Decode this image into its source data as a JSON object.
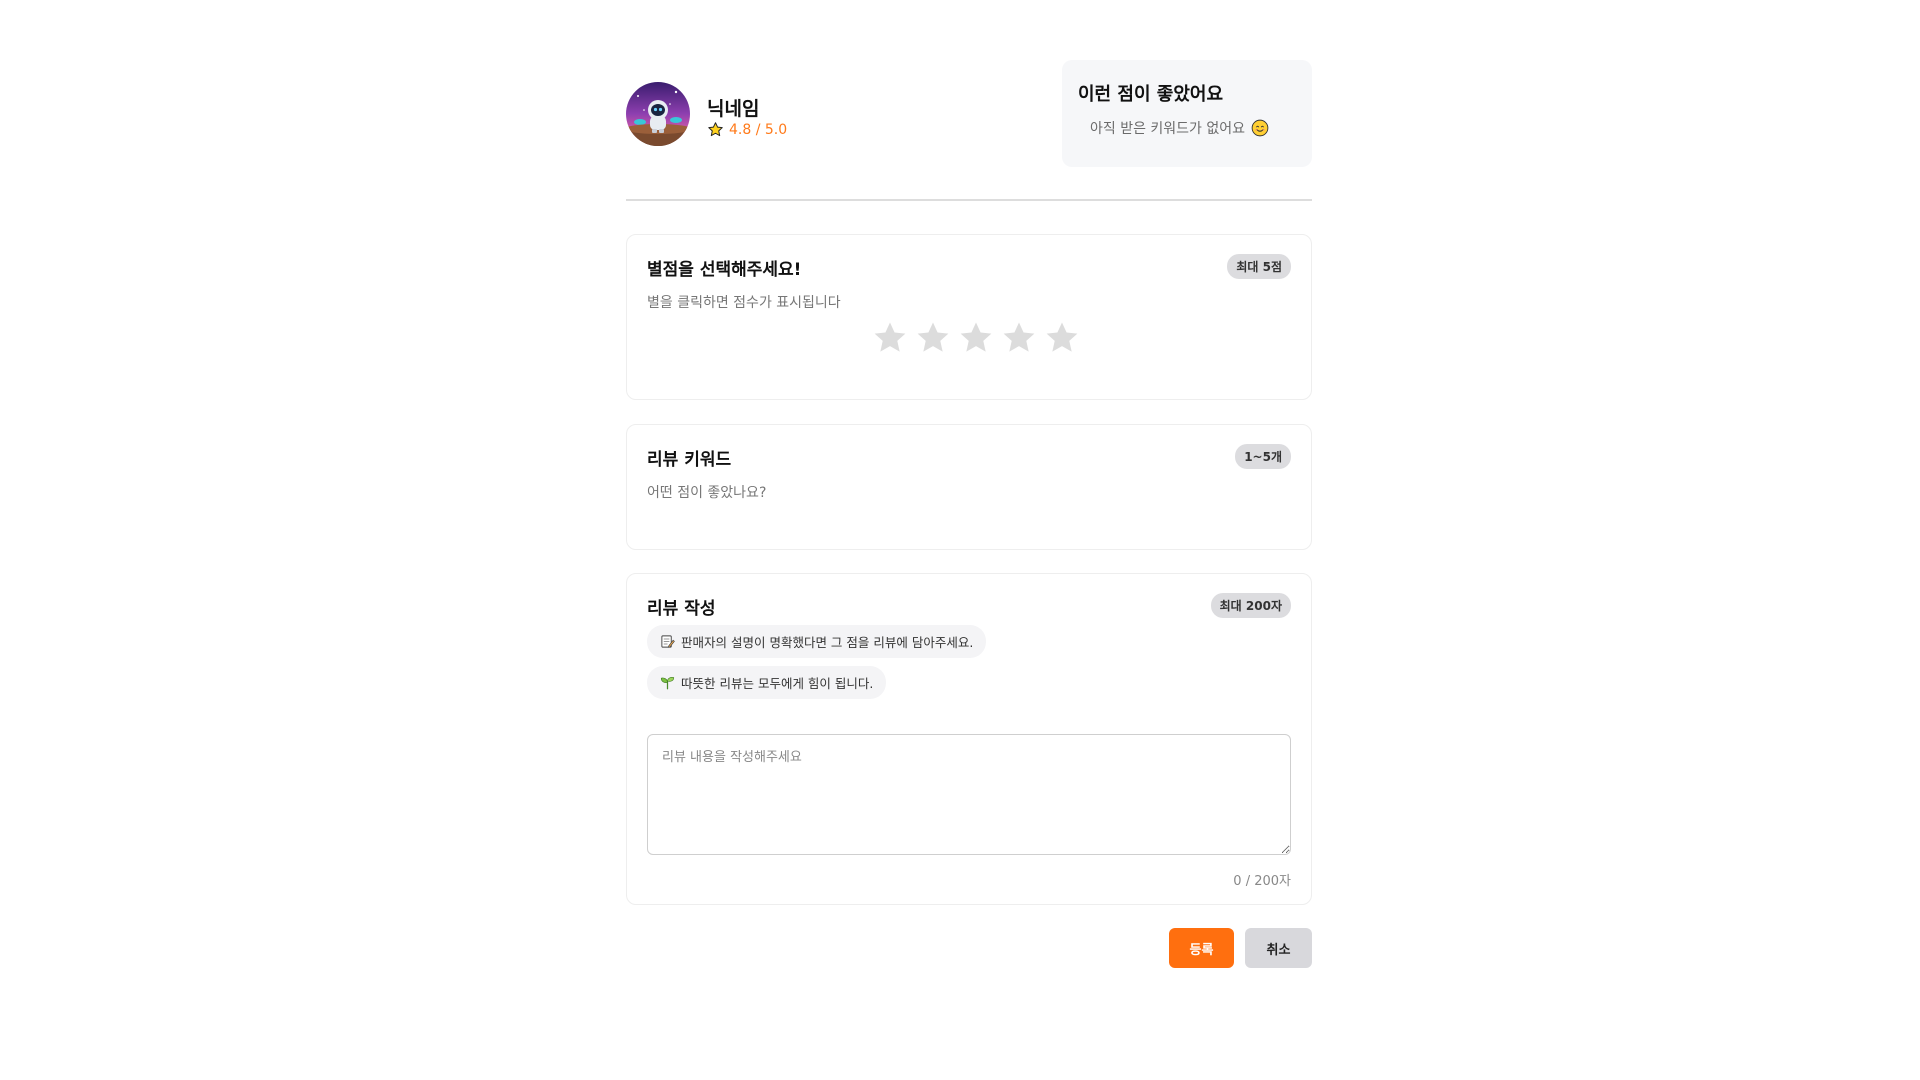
{
  "profile": {
    "nickname": "닉네임",
    "rating": "4.8 / 5.0",
    "avatar_icon": "astronaut-avatar-icon"
  },
  "good_points": {
    "title": "이런 점이 좋았어요",
    "empty_text": "아직 받은 키워드가 없어요",
    "empty_icon": "smile-emoji-icon"
  },
  "rating_section": {
    "title": "별점을 선택해주세요!",
    "subtitle": "별을 클릭하면 점수가 표시됩니다",
    "badge": "최대 5점",
    "max_stars": 5,
    "selected": 0,
    "star_empty_color": "#dcdcdc",
    "star_fill_color": "#ffc107"
  },
  "keyword_section": {
    "title": "리뷰 키워드",
    "subtitle": "어떤 점이 좋았나요?",
    "badge": "1~5개"
  },
  "review_section": {
    "title": "리뷰 작성",
    "badge": "최대 200자",
    "tips": [
      {
        "icon": "memo-emoji-icon",
        "text": "판매자의 설명이 명확했다면 그 점을 리뷰에 담아주세요."
      },
      {
        "icon": "seedling-emoji-icon",
        "text": "따뜻한 리뷰는 모두에게 힘이 됩니다."
      }
    ],
    "placeholder": "리뷰 내용을 작성해주세요",
    "value": "",
    "char_count": "0 / 200자"
  },
  "actions": {
    "submit_label": "등록",
    "cancel_label": "취소"
  },
  "colors": {
    "accent": "#ff6f0f",
    "rating_text": "#ff7a1a"
  }
}
